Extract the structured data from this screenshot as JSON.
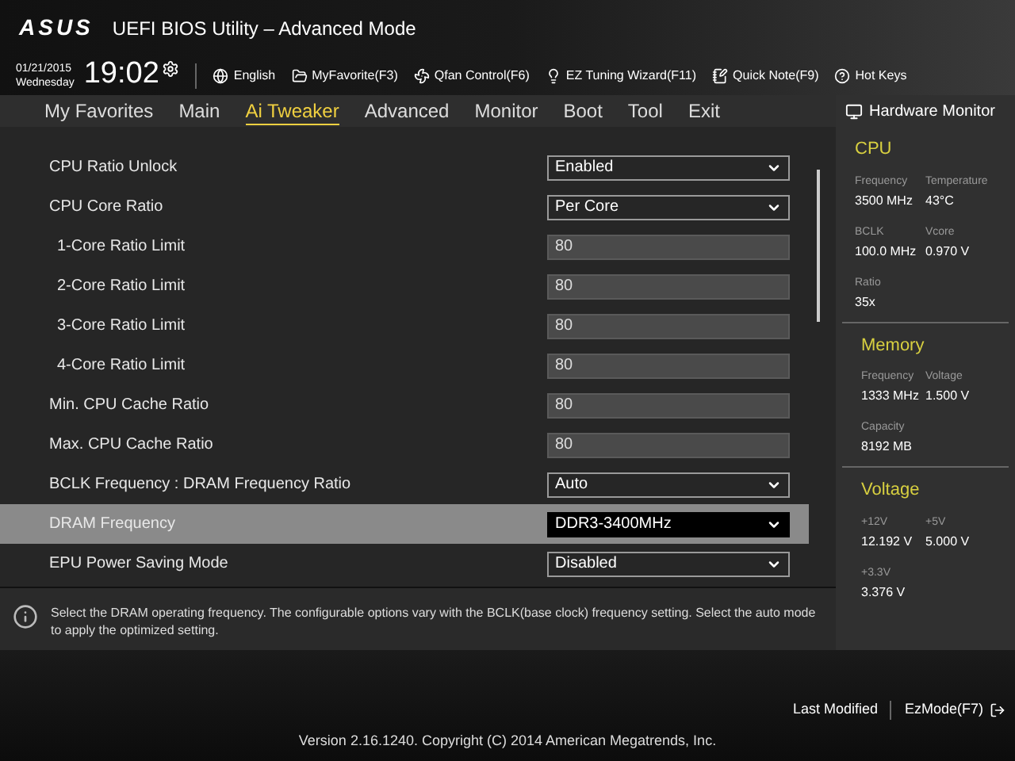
{
  "window": {
    "logo": "ASUS",
    "title": "UEFI BIOS Utility – Advanced Mode"
  },
  "toolbar": {
    "date": "01/21/2015",
    "weekday": "Wednesday",
    "time": "19:02",
    "items": [
      {
        "kind": "globe",
        "label": "English"
      },
      {
        "kind": "folder",
        "label": "MyFavorite(F3)"
      },
      {
        "kind": "fan",
        "label": "Qfan Control(F6)"
      },
      {
        "kind": "bulb",
        "label": "EZ Tuning Wizard(F11)"
      },
      {
        "kind": "note",
        "label": "Quick Note(F9)"
      },
      {
        "kind": "help",
        "label": "Hot Keys"
      }
    ]
  },
  "tabs": [
    {
      "label": "My Favorites",
      "selected": false
    },
    {
      "label": "Main",
      "selected": false
    },
    {
      "label": "Ai Tweaker",
      "selected": true
    },
    {
      "label": "Advanced",
      "selected": false
    },
    {
      "label": "Monitor",
      "selected": false
    },
    {
      "label": "Boot",
      "selected": false
    },
    {
      "label": "Tool",
      "selected": false
    },
    {
      "label": "Exit",
      "selected": false
    }
  ],
  "settings": [
    {
      "label": "CPU Ratio Unlock",
      "kind": "dropdown",
      "value": "Enabled",
      "selected": false
    },
    {
      "label": "CPU Core Ratio",
      "kind": "dropdown",
      "value": "Per Core",
      "selected": false,
      "children": [
        {
          "label": "1-Core Ratio Limit",
          "kind": "number",
          "value": "80",
          "selected": false
        },
        {
          "label": "2-Core Ratio Limit",
          "kind": "number",
          "value": "80",
          "selected": false
        },
        {
          "label": "3-Core Ratio Limit",
          "kind": "number",
          "value": "80",
          "selected": false
        },
        {
          "label": "4-Core Ratio Limit",
          "kind": "number",
          "value": "80",
          "selected": false
        }
      ]
    },
    {
      "label": "Min. CPU Cache Ratio",
      "kind": "number",
      "value": "80",
      "selected": false
    },
    {
      "label": "Max. CPU Cache Ratio",
      "kind": "number",
      "value": "80",
      "selected": false
    },
    {
      "label": "BCLK Frequency : DRAM Frequency Ratio",
      "kind": "dropdown",
      "value": "Auto",
      "selected": false
    },
    {
      "label": "DRAM Frequency",
      "kind": "dropdown",
      "value": "DDR3-3400MHz",
      "selected": true
    },
    {
      "label": "EPU Power Saving Mode",
      "kind": "dropdown",
      "value": "Disabled",
      "selected": false
    }
  ],
  "help_text": "Select the DRAM operating frequency. The configurable options vary with the BCLK(base clock) frequency setting. Select the auto mode to apply the optimized setting.",
  "hardware_monitor": {
    "title": "Hardware Monitor",
    "sections": [
      {
        "title": "CPU",
        "readings": [
          {
            "label": "Frequency",
            "value": "3500 MHz"
          },
          {
            "label": "Temperature",
            "value": "43°C"
          },
          {
            "label": "BCLK",
            "value": "100.0 MHz"
          },
          {
            "label": "Vcore",
            "value": "0.970 V"
          },
          {
            "label": "Ratio",
            "value": "35x"
          }
        ]
      },
      {
        "title": "Memory",
        "readings": [
          {
            "label": "Frequency",
            "value": "1333 MHz"
          },
          {
            "label": "Voltage",
            "value": "1.500 V"
          },
          {
            "label": "Capacity",
            "value": "8192 MB"
          }
        ]
      },
      {
        "title": "Voltage",
        "readings": [
          {
            "label": "+12V",
            "value": "12.192 V"
          },
          {
            "label": "+5V",
            "value": "5.000 V"
          },
          {
            "label": "+3.3V",
            "value": "3.376 V"
          }
        ]
      }
    ]
  },
  "footer": {
    "last_modified": "Last Modified",
    "ez_mode": "EzMode(F7)",
    "version": "Version 2.16.1240. Copyright (C) 2014 American Megatrends, Inc."
  }
}
